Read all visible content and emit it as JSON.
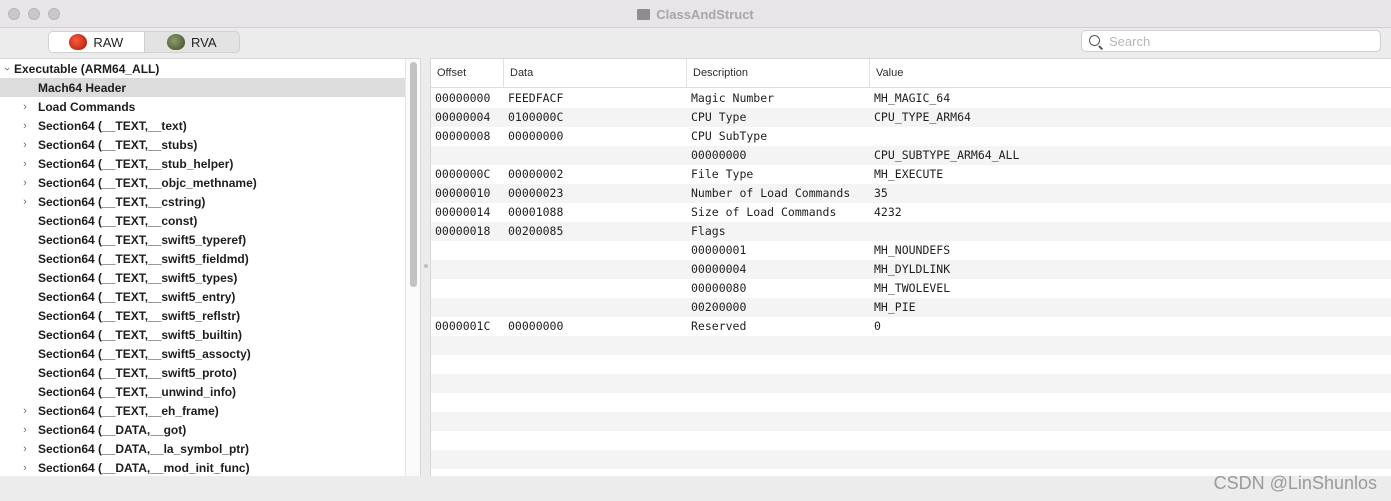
{
  "window": {
    "title": "ClassAndStruct"
  },
  "toolbar": {
    "segments": [
      {
        "label": "RAW",
        "icon": "raw-icon",
        "active": true
      },
      {
        "label": "RVA",
        "icon": "rva-icon",
        "active": false
      }
    ],
    "search": {
      "placeholder": "Search",
      "value": ""
    }
  },
  "tree": {
    "root": {
      "label": "Executable  (ARM64_ALL)",
      "expanded": true
    },
    "items": [
      {
        "label": "Mach64 Header",
        "expandable": false,
        "selected": true
      },
      {
        "label": "Load Commands",
        "expandable": true
      },
      {
        "label": "Section64 (__TEXT,__text)",
        "expandable": true
      },
      {
        "label": "Section64 (__TEXT,__stubs)",
        "expandable": true
      },
      {
        "label": "Section64 (__TEXT,__stub_helper)",
        "expandable": true
      },
      {
        "label": "Section64 (__TEXT,__objc_methname)",
        "expandable": true
      },
      {
        "label": "Section64 (__TEXT,__cstring)",
        "expandable": true
      },
      {
        "label": "Section64 (__TEXT,__const)",
        "expandable": false
      },
      {
        "label": "Section64 (__TEXT,__swift5_typeref)",
        "expandable": false
      },
      {
        "label": "Section64 (__TEXT,__swift5_fieldmd)",
        "expandable": false
      },
      {
        "label": "Section64 (__TEXT,__swift5_types)",
        "expandable": false
      },
      {
        "label": "Section64 (__TEXT,__swift5_entry)",
        "expandable": false
      },
      {
        "label": "Section64 (__TEXT,__swift5_reflstr)",
        "expandable": false
      },
      {
        "label": "Section64 (__TEXT,__swift5_builtin)",
        "expandable": false
      },
      {
        "label": "Section64 (__TEXT,__swift5_assocty)",
        "expandable": false
      },
      {
        "label": "Section64 (__TEXT,__swift5_proto)",
        "expandable": false
      },
      {
        "label": "Section64 (__TEXT,__unwind_info)",
        "expandable": false
      },
      {
        "label": "Section64 (__TEXT,__eh_frame)",
        "expandable": true
      },
      {
        "label": "Section64 (__DATA,__got)",
        "expandable": true
      },
      {
        "label": "Section64 (__DATA,__la_symbol_ptr)",
        "expandable": true
      },
      {
        "label": "Section64 (__DATA,__mod_init_func)",
        "expandable": true
      }
    ]
  },
  "table": {
    "columns": [
      "Offset",
      "Data",
      "Description",
      "Value"
    ],
    "rows": [
      [
        "00000000",
        "FEEDFACF",
        "Magic Number",
        "MH_MAGIC_64"
      ],
      [
        "00000004",
        "0100000C",
        "CPU Type",
        "CPU_TYPE_ARM64"
      ],
      [
        "00000008",
        "00000000",
        "CPU SubType",
        ""
      ],
      [
        "",
        "",
        "00000000",
        "CPU_SUBTYPE_ARM64_ALL"
      ],
      [
        "0000000C",
        "00000002",
        "File Type",
        "MH_EXECUTE"
      ],
      [
        "00000010",
        "00000023",
        "Number of Load Commands",
        "35"
      ],
      [
        "00000014",
        "00001088",
        "Size of Load Commands",
        "4232"
      ],
      [
        "00000018",
        "00200085",
        "Flags",
        ""
      ],
      [
        "",
        "",
        "00000001",
        "MH_NOUNDEFS"
      ],
      [
        "",
        "",
        "00000004",
        "MH_DYLDLINK"
      ],
      [
        "",
        "",
        "00000080",
        "MH_TWOLEVEL"
      ],
      [
        "",
        "",
        "00200000",
        "MH_PIE"
      ],
      [
        "0000001C",
        "00000000",
        "Reserved",
        "0"
      ]
    ],
    "empty_rows": 7
  },
  "watermark": "CSDN @LinShunlos"
}
